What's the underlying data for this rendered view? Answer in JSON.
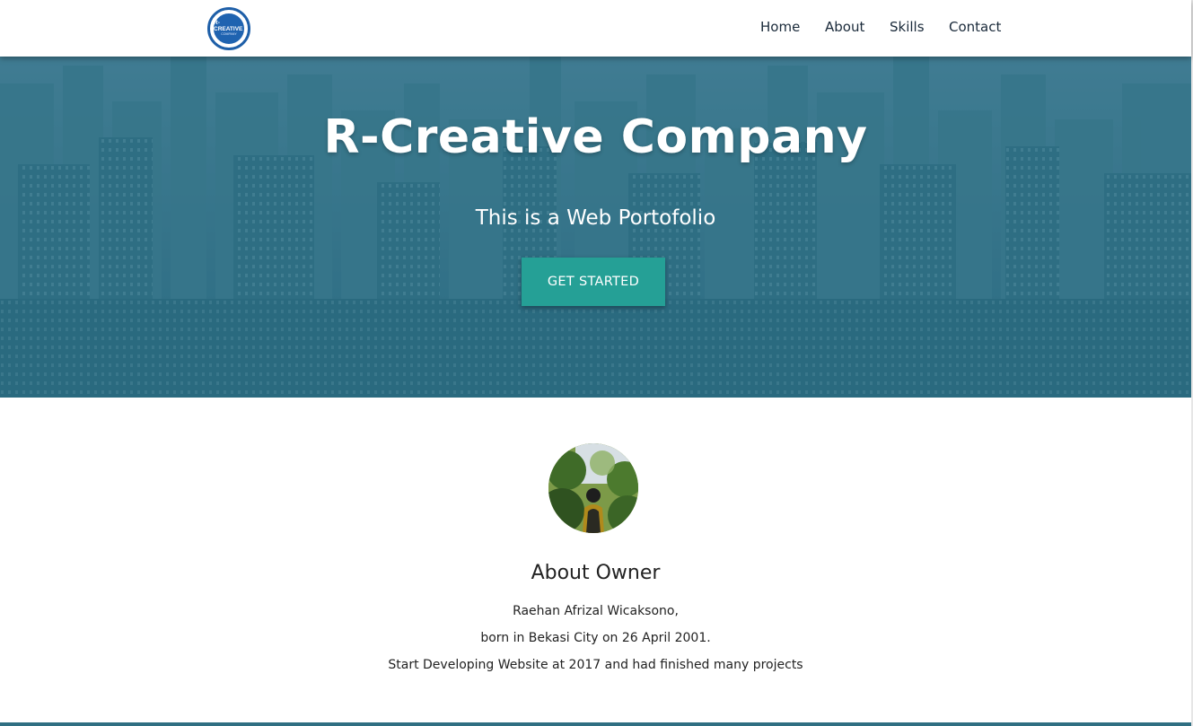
{
  "navbar": {
    "logo_text": "R-CREATIVE",
    "logo_sub": "COMPANY",
    "links": [
      "Home",
      "About",
      "Skills",
      "Contact"
    ]
  },
  "hero": {
    "title": "R-Creative Company",
    "subtitle": "This is a Web Portofolio",
    "button_label": "GET STARTED"
  },
  "about": {
    "heading": "About Owner",
    "lines": [
      "Raehan Afrizal Wicaksono,",
      "born in Bekasi City on 26 April 2001.",
      "Start Developing Website at 2017 and had finished many projects"
    ]
  },
  "colors": {
    "accent": "#25a096",
    "hero_overlay": "#1e6e87",
    "logo_blue": "#1f63b0",
    "nav_text": "#1a2a3a"
  }
}
